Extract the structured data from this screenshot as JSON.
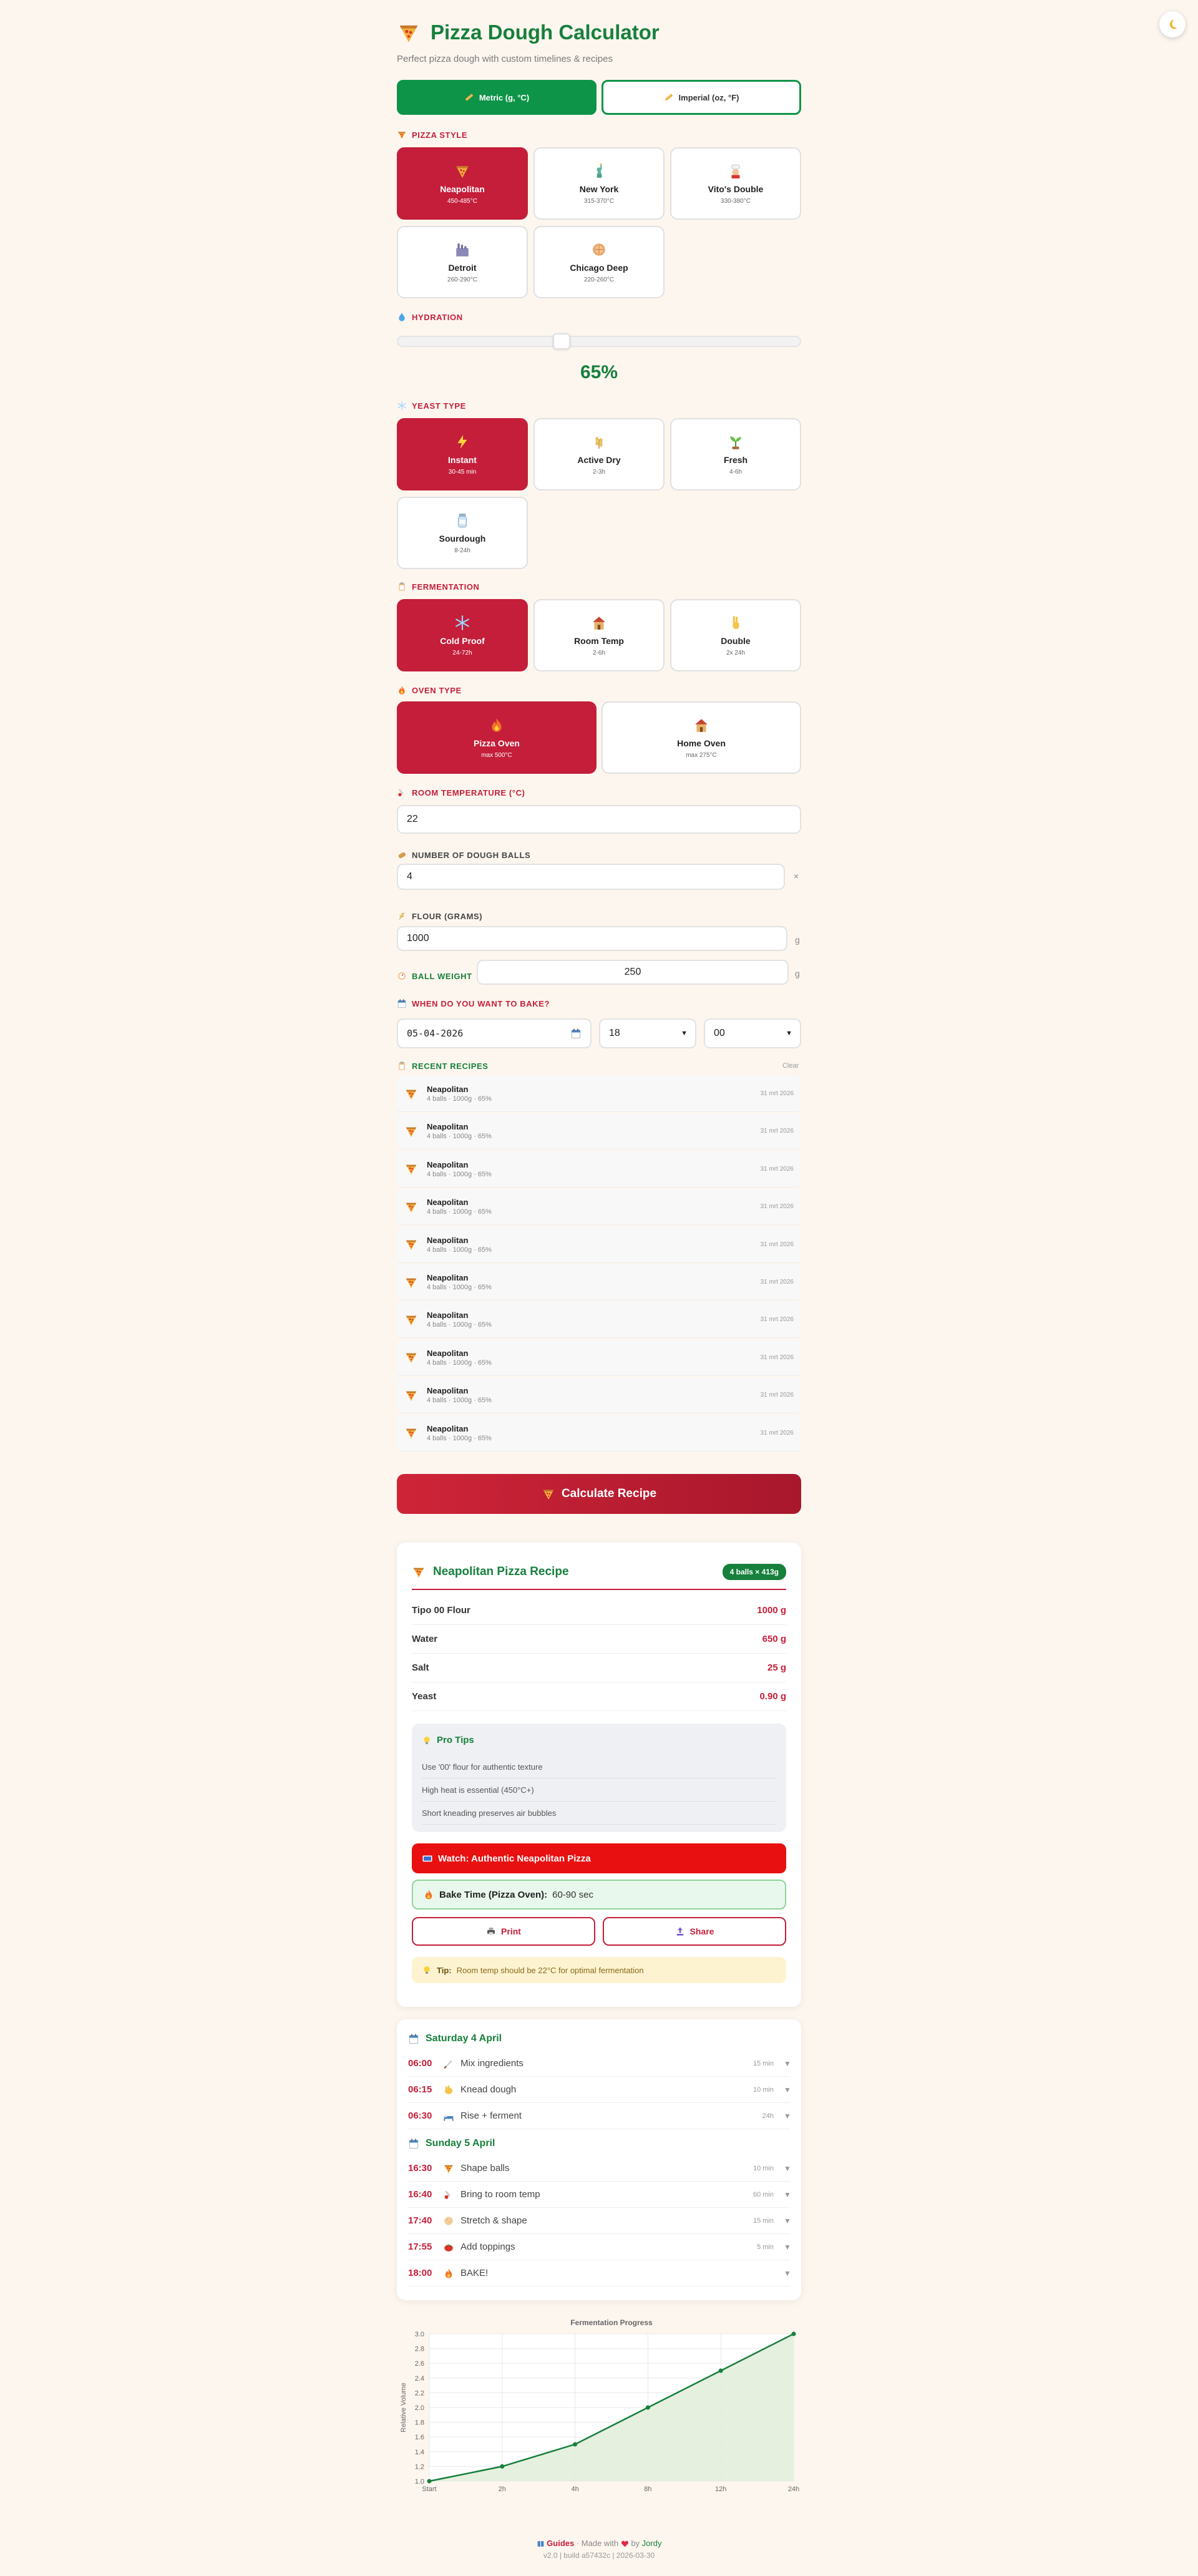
{
  "header": {
    "title": "Pizza Dough Calculator",
    "subtitle": "Perfect pizza dough with custom timelines & recipes"
  },
  "theme_toggle": {
    "icon": "moon-icon"
  },
  "units": {
    "metric": {
      "label": "Metric (g, °C)",
      "active": true
    },
    "imperial": {
      "label": "Imperial (oz, °F)",
      "active": false
    }
  },
  "pizza_style": {
    "label": "Pizza Style",
    "options": [
      {
        "name": "Neapolitan",
        "sub": "450-485°C",
        "icon": "pizza-icon",
        "selected": true
      },
      {
        "name": "New York",
        "sub": "315-370°C",
        "icon": "statue-icon",
        "selected": false
      },
      {
        "name": "Vito's Double",
        "sub": "330-380°C",
        "icon": "chef-icon",
        "selected": false
      },
      {
        "name": "Detroit",
        "sub": "260-290°C",
        "icon": "factory-icon",
        "selected": false
      },
      {
        "name": "Chicago Deep",
        "sub": "220-260°C",
        "icon": "pie-icon",
        "selected": false
      }
    ]
  },
  "hydration": {
    "label": "Hydration",
    "value": "65%",
    "level_fraction": 0.4
  },
  "yeast": {
    "label": "Yeast Type",
    "options": [
      {
        "name": "Instant",
        "sub": "30-45 min",
        "icon": "lightning-icon",
        "selected": true
      },
      {
        "name": "Active Dry",
        "sub": "2-3h",
        "icon": "grain-icon",
        "selected": false
      },
      {
        "name": "Fresh",
        "sub": "4-6h",
        "icon": "seedling-icon",
        "selected": false
      },
      {
        "name": "Sourdough",
        "sub": "8-24h",
        "icon": "jar-icon",
        "selected": false
      }
    ]
  },
  "fermentation": {
    "label": "Fermentation",
    "options": [
      {
        "name": "Cold Proof",
        "sub": "24-72h",
        "icon": "snowflake-icon",
        "selected": true
      },
      {
        "name": "Room Temp",
        "sub": "2-6h",
        "icon": "house-icon",
        "selected": false
      },
      {
        "name": "Double",
        "sub": "2x 24h",
        "icon": "peace-icon",
        "selected": false
      }
    ]
  },
  "oven": {
    "label": "Oven Type",
    "options": [
      {
        "name": "Pizza Oven",
        "sub": "max 500°C",
        "icon": "fire-icon",
        "selected": true
      },
      {
        "name": "Home Oven",
        "sub": "max 275°C",
        "icon": "house-icon",
        "selected": false
      }
    ]
  },
  "room_temp": {
    "label": "Room Temperature (°C)",
    "value": "22"
  },
  "dough_balls": {
    "label": "Number of Dough Balls",
    "value": "4",
    "suffix": "×"
  },
  "flour": {
    "label": "Flour (grams)",
    "value": "1000",
    "suffix": "g"
  },
  "ball_weight": {
    "label": "Ball Weight",
    "value": "250",
    "suffix": "g"
  },
  "bake_when": {
    "label": "When do you want to bake?",
    "date": "05-04-2026",
    "hour": "18",
    "minute": "00"
  },
  "recent": {
    "label": "Recent Recipes",
    "clear": "Clear",
    "items": [
      {
        "name": "Neapolitan",
        "meta": "4 balls · 1000g · 65%",
        "date": "31 mrt 2026"
      },
      {
        "name": "Neapolitan",
        "meta": "4 balls · 1000g · 65%",
        "date": "31 mrt 2026"
      },
      {
        "name": "Neapolitan",
        "meta": "4 balls · 1000g · 65%",
        "date": "31 mrt 2026"
      },
      {
        "name": "Neapolitan",
        "meta": "4 balls · 1000g · 65%",
        "date": "31 mrt 2026"
      },
      {
        "name": "Neapolitan",
        "meta": "4 balls · 1000g · 65%",
        "date": "31 mrt 2026"
      },
      {
        "name": "Neapolitan",
        "meta": "4 balls · 1000g · 65%",
        "date": "31 mrt 2026"
      },
      {
        "name": "Neapolitan",
        "meta": "4 balls · 1000g · 65%",
        "date": "31 mrt 2026"
      },
      {
        "name": "Neapolitan",
        "meta": "4 balls · 1000g · 65%",
        "date": "31 mrt 2026"
      },
      {
        "name": "Neapolitan",
        "meta": "4 balls · 1000g · 65%",
        "date": "31 mrt 2026"
      },
      {
        "name": "Neapolitan",
        "meta": "4 balls · 1000g · 65%",
        "date": "31 mrt 2026"
      }
    ]
  },
  "calculate_button": "Calculate Recipe",
  "recipe": {
    "title": "Neapolitan Pizza Recipe",
    "badge": "4 balls × 413g",
    "ingredients": [
      {
        "name": "Tipo 00 Flour",
        "value": "1000 g"
      },
      {
        "name": "Water",
        "value": "650 g"
      },
      {
        "name": "Salt",
        "value": "25 g"
      },
      {
        "name": "Yeast",
        "value": "0.90 g"
      }
    ],
    "tips_title": "Pro Tips",
    "tips": [
      "Use '00' flour for authentic texture",
      "High heat is essential (450°C+)",
      "Short kneading preserves air bubbles"
    ],
    "watch_label": "Watch: Authentic Neapolitan Pizza",
    "bake_time_label": "Bake Time (Pizza Oven):",
    "bake_time_value": "60-90 sec",
    "print_label": "Print",
    "share_label": "Share",
    "note_label": "Tip:",
    "note_text": "Room temp should be 22°C for optimal fermentation"
  },
  "timeline": {
    "days": [
      {
        "label": "Saturday 4 April",
        "steps": [
          {
            "time": "06:00",
            "icon": "knife-icon",
            "label": "Mix ingredients",
            "duration": "15 min"
          },
          {
            "time": "06:15",
            "icon": "hand-icon",
            "label": "Knead dough",
            "duration": "10 min"
          },
          {
            "time": "06:30",
            "icon": "sleep-icon",
            "label": "Rise + ferment",
            "duration": "24h"
          }
        ]
      },
      {
        "label": "Sunday 5 April",
        "steps": [
          {
            "time": "16:30",
            "icon": "pizza-icon",
            "label": "Shape balls",
            "duration": "10 min"
          },
          {
            "time": "16:40",
            "icon": "thermometer-icon",
            "label": "Bring to room temp",
            "duration": "60 min"
          },
          {
            "time": "17:40",
            "icon": "dough-icon",
            "label": "Stretch & shape",
            "duration": "15 min"
          },
          {
            "time": "17:55",
            "icon": "tomato-icon",
            "label": "Add toppings",
            "duration": "5 min"
          },
          {
            "time": "18:00",
            "icon": "fire-icon",
            "label": "BAKE!",
            "duration": ""
          }
        ]
      }
    ]
  },
  "chart_data": {
    "type": "area",
    "title": "Fermentation Progress",
    "xlabel": "",
    "ylabel": "Relative Volume",
    "categories": [
      "Start",
      "2h",
      "4h",
      "8h",
      "12h",
      "24h"
    ],
    "series": [
      {
        "values": [
          1.0,
          1.2,
          1.5,
          2.0,
          2.5,
          3.0
        ]
      }
    ],
    "ylim": [
      1.0,
      3.0
    ],
    "yticks": [
      "1.0",
      "1.2",
      "1.4",
      "1.6",
      "1.8",
      "2.0",
      "2.2",
      "2.4",
      "2.6",
      "2.8",
      "3.0"
    ],
    "grid": true,
    "colors": {
      "line": "#16803c",
      "fill": "#e3eedb"
    }
  },
  "footer": {
    "guides": "Guides",
    "made_with": "· Made with",
    "by": "by",
    "author": "Jordy",
    "version": "v2.0 | build a57432c | 2026-03-30"
  },
  "colors": {
    "accent_red": "#c41e3a",
    "accent_green": "#16803c",
    "background": "#fdf6ef"
  }
}
